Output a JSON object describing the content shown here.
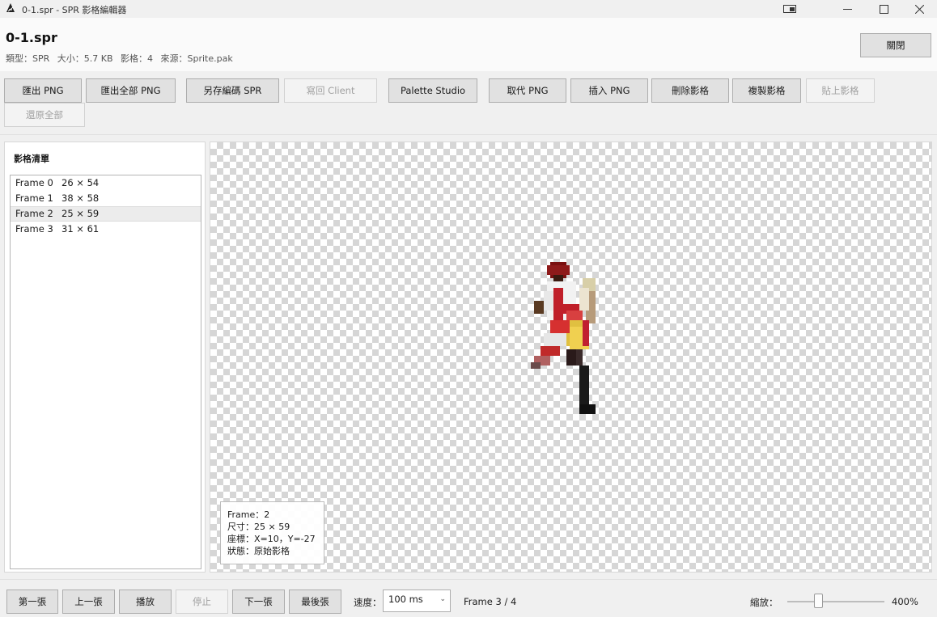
{
  "window": {
    "title": "0-1.spr - SPR 影格編輯器",
    "controls": [
      "snap-layout",
      "minimize",
      "maximize",
      "close"
    ]
  },
  "header": {
    "file_name": "0-1.spr",
    "type": "類型：SPR",
    "size": "大小：5.7 KB",
    "frames": "影格：4",
    "source": "來源：Sprite.pak",
    "close_label": "關閉"
  },
  "toolbar": {
    "buttons": [
      {
        "label": "匯出 PNG",
        "enabled": true
      },
      {
        "label": "匯出全部 PNG",
        "enabled": true
      },
      {
        "label": "另存編碼 SPR",
        "enabled": true
      },
      {
        "label": "寫回 Client",
        "enabled": false
      },
      {
        "label": "Palette Studio",
        "enabled": true
      },
      {
        "label": "取代 PNG",
        "enabled": true
      },
      {
        "label": "插入 PNG",
        "enabled": true
      },
      {
        "label": "刪除影格",
        "enabled": true
      },
      {
        "label": "複製影格",
        "enabled": true
      },
      {
        "label": "貼上影格",
        "enabled": false
      },
      {
        "label": "還原全部",
        "enabled": false
      }
    ]
  },
  "frame_panel": {
    "title": "影格清單",
    "frames": [
      {
        "name": "Frame 0",
        "dims": "26 × 54",
        "selected": false
      },
      {
        "name": "Frame 1",
        "dims": "38 × 58",
        "selected": false
      },
      {
        "name": "Frame 2",
        "dims": "25 × 59",
        "selected": true
      },
      {
        "name": "Frame 3",
        "dims": "31 × 61",
        "selected": false
      }
    ]
  },
  "preview": {
    "info": {
      "frame": "Frame：2",
      "size": "尺寸：25 × 59",
      "coords": "座標：X=10，Y=-27",
      "status": "狀態：原始影格"
    }
  },
  "playback": {
    "buttons": [
      {
        "label": "第一張",
        "enabled": true
      },
      {
        "label": "上一張",
        "enabled": true
      },
      {
        "label": "播放",
        "enabled": true
      },
      {
        "label": "停止",
        "enabled": false
      },
      {
        "label": "下一張",
        "enabled": true
      },
      {
        "label": "最後張",
        "enabled": true
      }
    ],
    "speed_label": "速度：",
    "speed_value": "100 ms",
    "frame_counter": "Frame 3 / 4",
    "zoom_label": "縮放：",
    "zoom_value": "400%"
  }
}
